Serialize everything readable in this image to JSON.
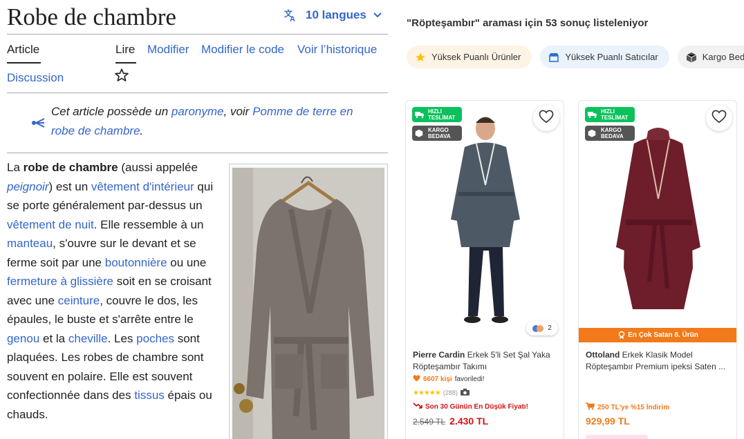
{
  "wiki": {
    "title": "Robe de chambre",
    "languages_label": "10 langues",
    "tabs": {
      "article": "Article",
      "discussion": "Discussion",
      "lire": "Lire",
      "modifier": "Modifier",
      "modifier_code": "Modifier le code",
      "historique": "Voir l’historique"
    },
    "hatnote": {
      "t1": "Cet article possède un ",
      "l1": "paronyme",
      "t2": ", voir ",
      "l2": "Pomme de terre en robe de chambre",
      "t3": "."
    },
    "body": [
      {
        "t": "La "
      },
      {
        "b": "robe de chambre"
      },
      {
        "t": " (aussi appelée "
      },
      {
        "li": "peignoir"
      },
      {
        "t": ") est un "
      },
      {
        "l": "vêtement d'intérieur"
      },
      {
        "t": " qui se porte généralement par-dessus un "
      },
      {
        "l": "vêtement de nuit"
      },
      {
        "t": ". Elle ressemble à un "
      },
      {
        "l": "manteau"
      },
      {
        "t": ", s'ouvre sur le devant et se ferme soit par une "
      },
      {
        "l": "boutonnière"
      },
      {
        "t": " ou une "
      },
      {
        "l": "fermeture à glissière"
      },
      {
        "t": " soit en se croisant avec une "
      },
      {
        "l": "ceinture"
      },
      {
        "t": ", couvre le dos, les épaules, le buste et s'arrête entre le "
      },
      {
        "l": "genou"
      },
      {
        "t": " et la "
      },
      {
        "l": "cheville"
      },
      {
        "t": ". Les "
      },
      {
        "l": "poches"
      },
      {
        "t": " sont plaquées. Les robes de chambre sont souvent en polaire. Elle est souvent confectionnée dans des "
      },
      {
        "l": "tissus"
      },
      {
        "t": " épais ou chauds."
      }
    ]
  },
  "shop": {
    "result_text": "\"Röpteşambır\" araması için 53 sonuç listeleniyor",
    "chips": [
      {
        "label": "Yüksek Puanlı Ürünler",
        "icon": "star-icon"
      },
      {
        "label": "Yüksek Puanlı Satıcılar",
        "icon": "store-icon"
      },
      {
        "label": "Kargo Bedava",
        "icon": "box-icon"
      }
    ],
    "badges": {
      "fast_l1": "HIZLI",
      "fast_l2": "TESLİMAT",
      "cargo_l1": "KARGO",
      "cargo_l2": "BEDAVA"
    },
    "products": [
      {
        "brand": "Pierre Cardin",
        "name": "Erkek 5'li Set Şal Yaka Röpteşambır Takımı",
        "fav_count": "6607 kişi",
        "fav_suffix": "favoriledi!",
        "rating": 4.5,
        "reviews": "(288)",
        "variants": "2",
        "deal_text": "Son 30 Günün En Düşük Fiyatı!",
        "old_price": "2.549 TL",
        "price": "2.430 TL"
      },
      {
        "brand": "Ottoland",
        "name": "Erkek Klasik Model Röpteşambır Premium ipeksi Saten ...",
        "best_seller": "En Çok Satan 8. Ürün",
        "promo": "250 TL'ye %15 İndirim",
        "price": "929,99 TL"
      }
    ]
  },
  "colors": {
    "wiki_link": "#3366cc",
    "accent_orange": "#f27a1a",
    "fast_green": "#0bc15c",
    "price_red": "#d21313"
  }
}
